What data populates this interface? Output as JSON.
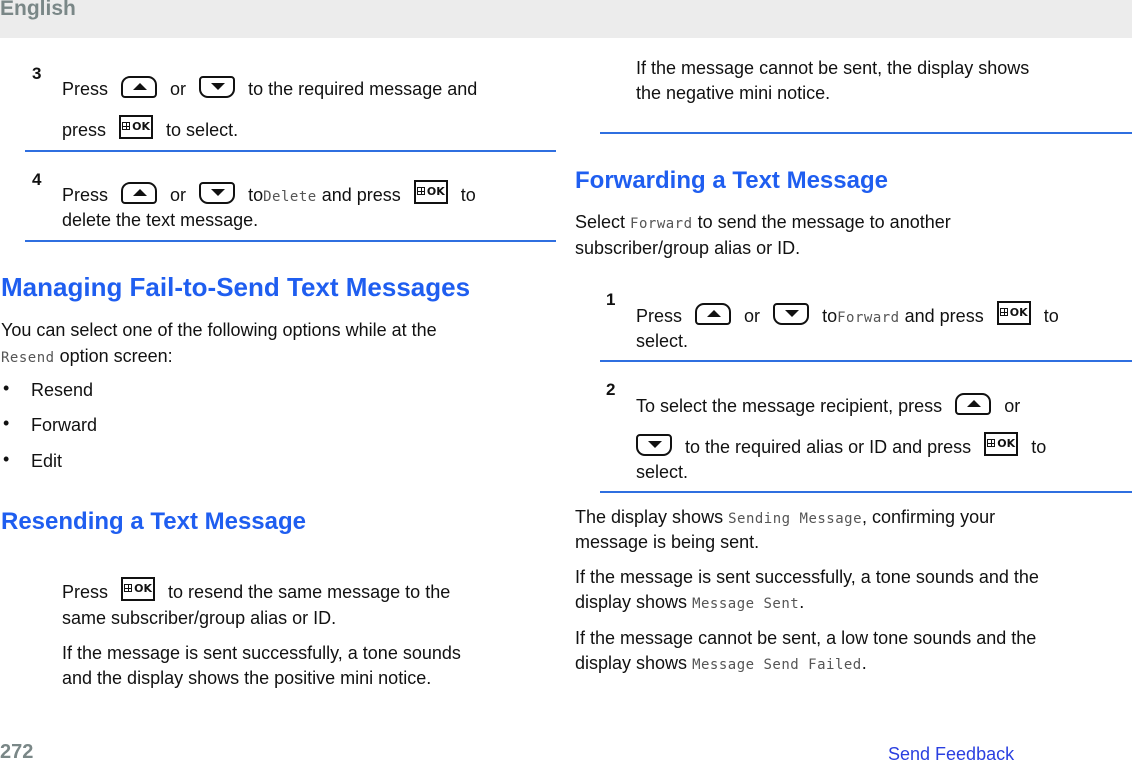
{
  "header": {
    "language": "English"
  },
  "left": {
    "step3": {
      "number": "3",
      "line1": {
        "press": "Press",
        "or": "or",
        "rest": "to the required message and"
      },
      "line2": {
        "press": "press",
        "rest": "to select."
      }
    },
    "step4": {
      "number": "4",
      "press": "Press",
      "or": "or",
      "to": "to",
      "display_value": "Delete",
      "and_press": "and press",
      "to2": "to",
      "line2": "delete the text message."
    },
    "managing": {
      "heading": "Managing Fail-to-Send Text Messages",
      "intro_line1": "You can select one of the following options while at the",
      "intro_display": "Resend",
      "intro_line2_rest": "option screen:",
      "options": [
        "Resend",
        "Forward",
        "Edit"
      ]
    },
    "resending": {
      "heading": "Resending a Text Message",
      "press": "Press",
      "line1_rest": "to resend the same message to the",
      "line2": "same subscriber/group alias or ID.",
      "success_line1": "If the message is sent successfully, a tone sounds",
      "success_line2": "and the display shows the positive mini notice."
    }
  },
  "right": {
    "fail_line1": "If the message cannot be sent, the display shows",
    "fail_line2": "the negative mini notice.",
    "forwarding": {
      "heading": "Forwarding a Text Message",
      "intro_select": "Select",
      "intro_display": "Forward",
      "intro_rest": "to send the message to another",
      "intro_line2": "subscriber/group alias or ID.",
      "step1": {
        "number": "1",
        "press": "Press",
        "or": "or",
        "to": "to",
        "display_value": "Forward",
        "and_press": "and press",
        "to2": "to",
        "line2": "select."
      },
      "step2": {
        "number": "2",
        "line1": "To select the message recipient, press",
        "or": "or",
        "line2_rest": "to the required alias or ID and press",
        "to": "to",
        "line3": "select."
      },
      "sending_pre": "The display shows",
      "sending_display": "Sending Message",
      "sending_post": ", confirming your",
      "sending_line2": "message is being sent.",
      "sent_line1": "If the message is sent successfully, a tone sounds and the",
      "sent_pre": "display shows",
      "sent_display": "Message Sent",
      "sent_post": ".",
      "failed_line1": "If the message cannot be sent, a low tone sounds and the",
      "failed_pre": "display shows",
      "failed_display": "Message Send Failed",
      "failed_post": "."
    }
  },
  "footer": {
    "page_number": "272",
    "feedback_link": "Send Feedback"
  },
  "colors": {
    "heading_blue": "#1f5ef0",
    "rule_blue": "#2f6fe0",
    "link_blue": "#2a3fe0",
    "header_gray": "#7a8787"
  }
}
